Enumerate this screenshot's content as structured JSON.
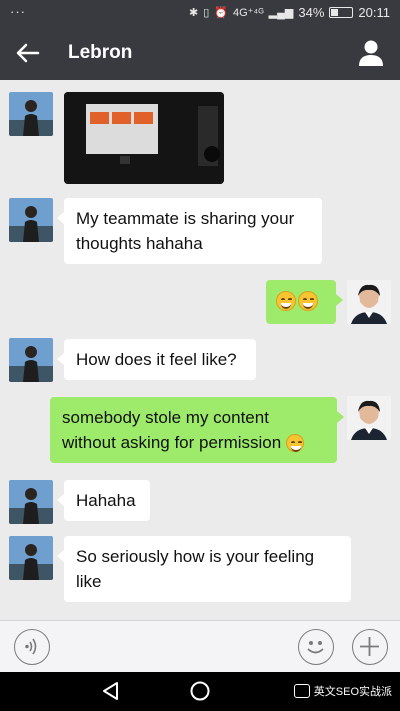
{
  "statusbar": {
    "dots": "···",
    "network": "4G⁺⁴ᴳ",
    "battery_percent": "34%",
    "battery_level": 0.34,
    "time": "20:11"
  },
  "header": {
    "title": "Lebron",
    "back_icon": "back-arrow-icon",
    "profile_icon": "person-icon"
  },
  "messages": [
    {
      "side": "in",
      "type": "image",
      "content": "photo of presentation screen"
    },
    {
      "side": "in",
      "type": "text",
      "text": "My teammate is sharing your thoughts hahaha"
    },
    {
      "side": "out",
      "type": "emoji",
      "emojis": [
        "grinning-emoji",
        "grinning-emoji"
      ]
    },
    {
      "side": "in",
      "type": "text",
      "text": "How does it feel like?"
    },
    {
      "side": "out",
      "type": "text",
      "text": "somebody stole my content without asking for permission",
      "trailing_emoji": "awkward-emoji"
    },
    {
      "side": "in",
      "type": "text",
      "text": "Hahaha"
    },
    {
      "side": "in",
      "type": "text",
      "text": "So seriously how is your feeling like"
    }
  ],
  "inputbar": {
    "voice_icon": "voice-icon",
    "emoji_icon": "smiley-icon",
    "more_icon": "plus-icon"
  },
  "navbar": {
    "back_icon": "triangle-back-icon",
    "home_icon": "circle-home-icon",
    "watermark_text": "英文SEO实战派"
  },
  "colors": {
    "header_bg": "#393a3f",
    "chat_bg": "#ebebeb",
    "incoming_bubble": "#ffffff",
    "outgoing_bubble": "#9eea6a"
  }
}
